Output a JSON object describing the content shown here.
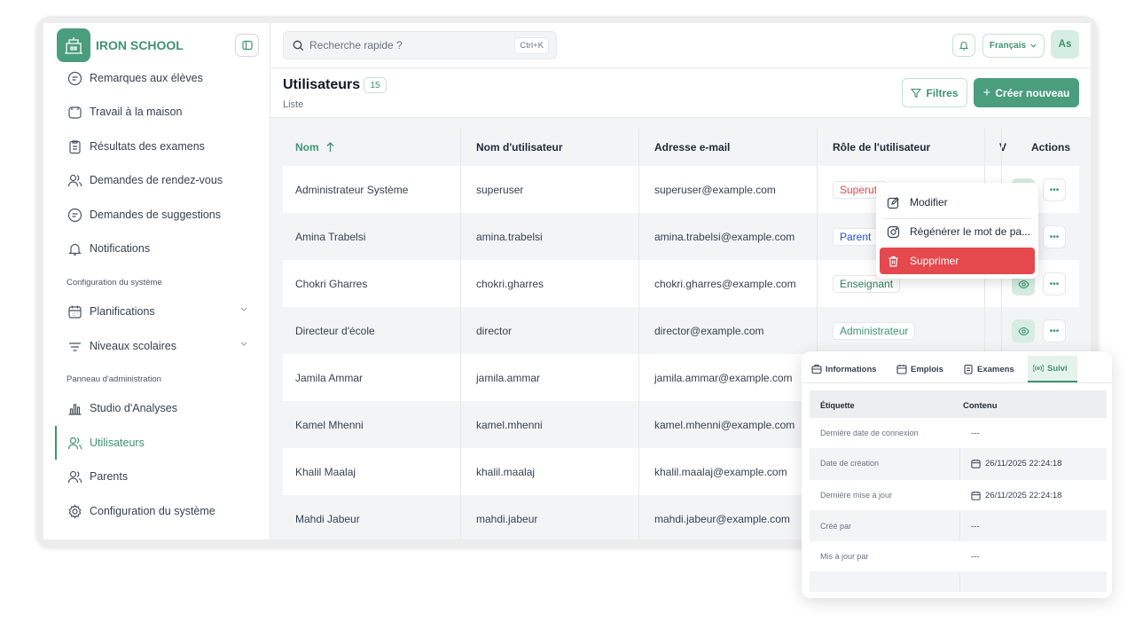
{
  "brand": {
    "name": "IRON SCHOOL"
  },
  "search": {
    "placeholder": "Recherche rapide ?",
    "shortcut": "Ctrl+K"
  },
  "topbar": {
    "language": "Français",
    "avatar_initials": "As"
  },
  "sidebar": {
    "items_top": [
      {
        "label": "Remarques aux élèves",
        "icon": "chat-icon"
      },
      {
        "label": "Travail à la maison",
        "icon": "bag-icon"
      },
      {
        "label": "Résultats des examens",
        "icon": "clipboard-icon"
      },
      {
        "label": "Demandes de rendez-vous",
        "icon": "users-icon"
      },
      {
        "label": "Demandes de suggestions",
        "icon": "chat-icon"
      },
      {
        "label": "Notifications",
        "icon": "bell-icon"
      }
    ],
    "section_config": "Configuration du système",
    "items_config": [
      {
        "label": "Planifications",
        "icon": "calendar-icon"
      },
      {
        "label": "Niveaux scolaires",
        "icon": "filter-lines-icon"
      }
    ],
    "section_admin": "Panneau d'administration",
    "items_admin": [
      {
        "label": "Studio d'Analyses",
        "icon": "bar-chart-icon"
      },
      {
        "label": "Utilisateurs",
        "icon": "users-icon",
        "active": true
      },
      {
        "label": "Parents",
        "icon": "users-icon"
      },
      {
        "label": "Configuration du système",
        "icon": "gear-icon"
      }
    ]
  },
  "page": {
    "title": "Utilisateurs",
    "count": "15",
    "subtitle": "Liste",
    "filters_label": "Filtres",
    "create_label": "Créer nouveau"
  },
  "table": {
    "columns": [
      "Nom",
      "Nom d'utilisateur",
      "Adresse e-mail",
      "Rôle de l'utilisateur",
      "V",
      "Actions"
    ],
    "rows": [
      {
        "name": "Administrateur Système",
        "username": "superuser",
        "email": "superuser@example.com",
        "role": "Superuti",
        "role_color": "#e5484d"
      },
      {
        "name": "Amina Trabelsi",
        "username": "amina.trabelsi",
        "email": "amina.trabelsi@example.com",
        "role": "Parent",
        "role_color": "#1d4ed8"
      },
      {
        "name": "Chokri Gharres",
        "username": "chokri.gharres",
        "email": "chokri.gharres@example.com",
        "role": "Enseignant",
        "role_color": "#2f7d5d"
      },
      {
        "name": "Directeur d'école",
        "username": "director",
        "email": "director@example.com",
        "role": "Administrateur",
        "role_color": "#3e9470"
      },
      {
        "name": "Jamila Ammar",
        "username": "jamila.ammar",
        "email": "jamila.ammar@example.com",
        "role": "",
        "role_color": "#374151"
      },
      {
        "name": "Kamel Mhenni",
        "username": "kamel.mhenni",
        "email": "kamel.mhenni@example.com",
        "role": "",
        "role_color": "#374151"
      },
      {
        "name": "Khalil Maalaj",
        "username": "khalil.maalaj",
        "email": "khalil.maalaj@example.com",
        "role": "",
        "role_color": "#374151"
      },
      {
        "name": "Mahdi Jabeur",
        "username": "mahdi.jabeur",
        "email": "mahdi.jabeur@example.com",
        "role": "",
        "role_color": "#374151"
      }
    ]
  },
  "context_menu": {
    "edit": "Modifier",
    "reset_password": "Régénérer le mot de pa...",
    "delete": "Supprimer"
  },
  "panel": {
    "tabs": [
      "Informations",
      "Emplois",
      "Examens",
      "Suivi"
    ],
    "active_tab": "Suivi",
    "header_label": "Étiquette",
    "header_value": "Contenu",
    "rows": [
      {
        "label": "Dernière date de connexion",
        "value": "---"
      },
      {
        "label": "Date de création",
        "value": "26/11/2025 22:24:18"
      },
      {
        "label": "Dernière mise à jour",
        "value": "26/11/2025 22:24:18"
      },
      {
        "label": "Créé par",
        "value": "---"
      },
      {
        "label": "Mis à jour par",
        "value": "---"
      }
    ]
  },
  "colors": {
    "accent": "#3e9470",
    "danger": "#e5484d"
  }
}
